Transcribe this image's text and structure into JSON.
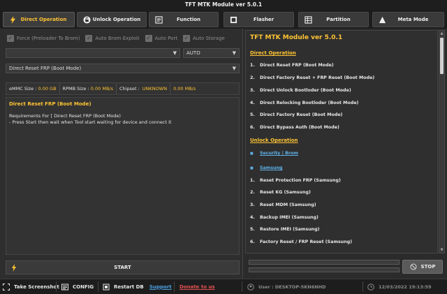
{
  "window": {
    "title": "TFT MTK Module ver 5.0.1"
  },
  "tabs": [
    {
      "label": "Direct Operation",
      "icon": "bolt-icon"
    },
    {
      "label": "Unlock Operation",
      "icon": "unlock-icon"
    },
    {
      "label": "Function",
      "icon": "function-icon"
    },
    {
      "label": "Flasher",
      "icon": "flasher-icon"
    },
    {
      "label": "Partition",
      "icon": "partition-icon"
    },
    {
      "label": "Meta Mode",
      "icon": "meta-icon"
    }
  ],
  "options": {
    "force_label": "Force (Preloader To Brom)",
    "auto_brom_label": "Auto Brom Exploit",
    "auto_port_label": "Auto Port",
    "auto_storage_label": "Auto Storage"
  },
  "port_select": {
    "value": ""
  },
  "storage_select": {
    "value": "AUTO"
  },
  "operation_select": {
    "value": "Direct Reset FRP (Boot Mode)"
  },
  "info": {
    "emmc_label": "eMMC Size :",
    "emmc_value": "0.00 GB",
    "rpmb_label": "RPMB Size :",
    "rpmb_value": "0.00 MB/s",
    "chipset_label": "Chipset :",
    "chipset_value": "UNKNOWN",
    "speed_value": "0.00 MB/s"
  },
  "log": {
    "title": "Direct Reset FRP (Boot Mode)",
    "lines": [
      "Requirements For [ Direct Reset FRP (Boot Mode)",
      " - Press Start then wait when Tool start waiting for device and connect it"
    ]
  },
  "start_label": "START",
  "operations_panel": {
    "header": "TFT MTK Module ver 5.0.1",
    "direct_section": "Direct Operation",
    "direct_items": [
      {
        "num": "1.",
        "label": "Direct Reset FRP (Boot Mode)"
      },
      {
        "num": "2.",
        "label": "Direct Factory Reset + FRP Reset (Boot Mode)"
      },
      {
        "num": "3.",
        "label": "Direct Unlock Bootloder (Boot Mode)"
      },
      {
        "num": "4.",
        "label": "Direct Relocking Bootloder (Boot Mode)"
      },
      {
        "num": "5.",
        "label": "Direct Factory Reset (Boot Mode)"
      },
      {
        "num": "6.",
        "label": "Direct Bypass Auth (Boot Mode)"
      }
    ],
    "unlock_section": "Unlock Operation",
    "unlock_links": [
      {
        "num": "■",
        "label": "Security | Brom"
      },
      {
        "num": "■",
        "label": "Samsung"
      }
    ],
    "unlock_items": [
      {
        "num": "1.",
        "label": "Reset Protection FRP (Samsung)"
      },
      {
        "num": "2.",
        "label": "Reset KG (Samsung)"
      },
      {
        "num": "3.",
        "label": "Reset MDM (Samsung)"
      },
      {
        "num": "4.",
        "label": "Backup IMEI (Samsung)"
      },
      {
        "num": "5.",
        "label": "Restore IMEI (Samsung)"
      },
      {
        "num": "6.",
        "label": "Factory Reset / FRP Reset (Samsung)"
      }
    ]
  },
  "stop_label": "STOP",
  "statusbar": {
    "screenshot_label": "Take Screenshot",
    "config_label": "CONFIG",
    "restart_label": "Restart DB",
    "support_label": "Support",
    "donate_label": "Donate to us",
    "user_text": "User : DESKTOP-5KN6NHD",
    "datetime": "12/03/2022 19:13:59"
  },
  "colors": {
    "accent": "#ffc433",
    "link": "#5fb1e8",
    "donate": "#e05050"
  }
}
